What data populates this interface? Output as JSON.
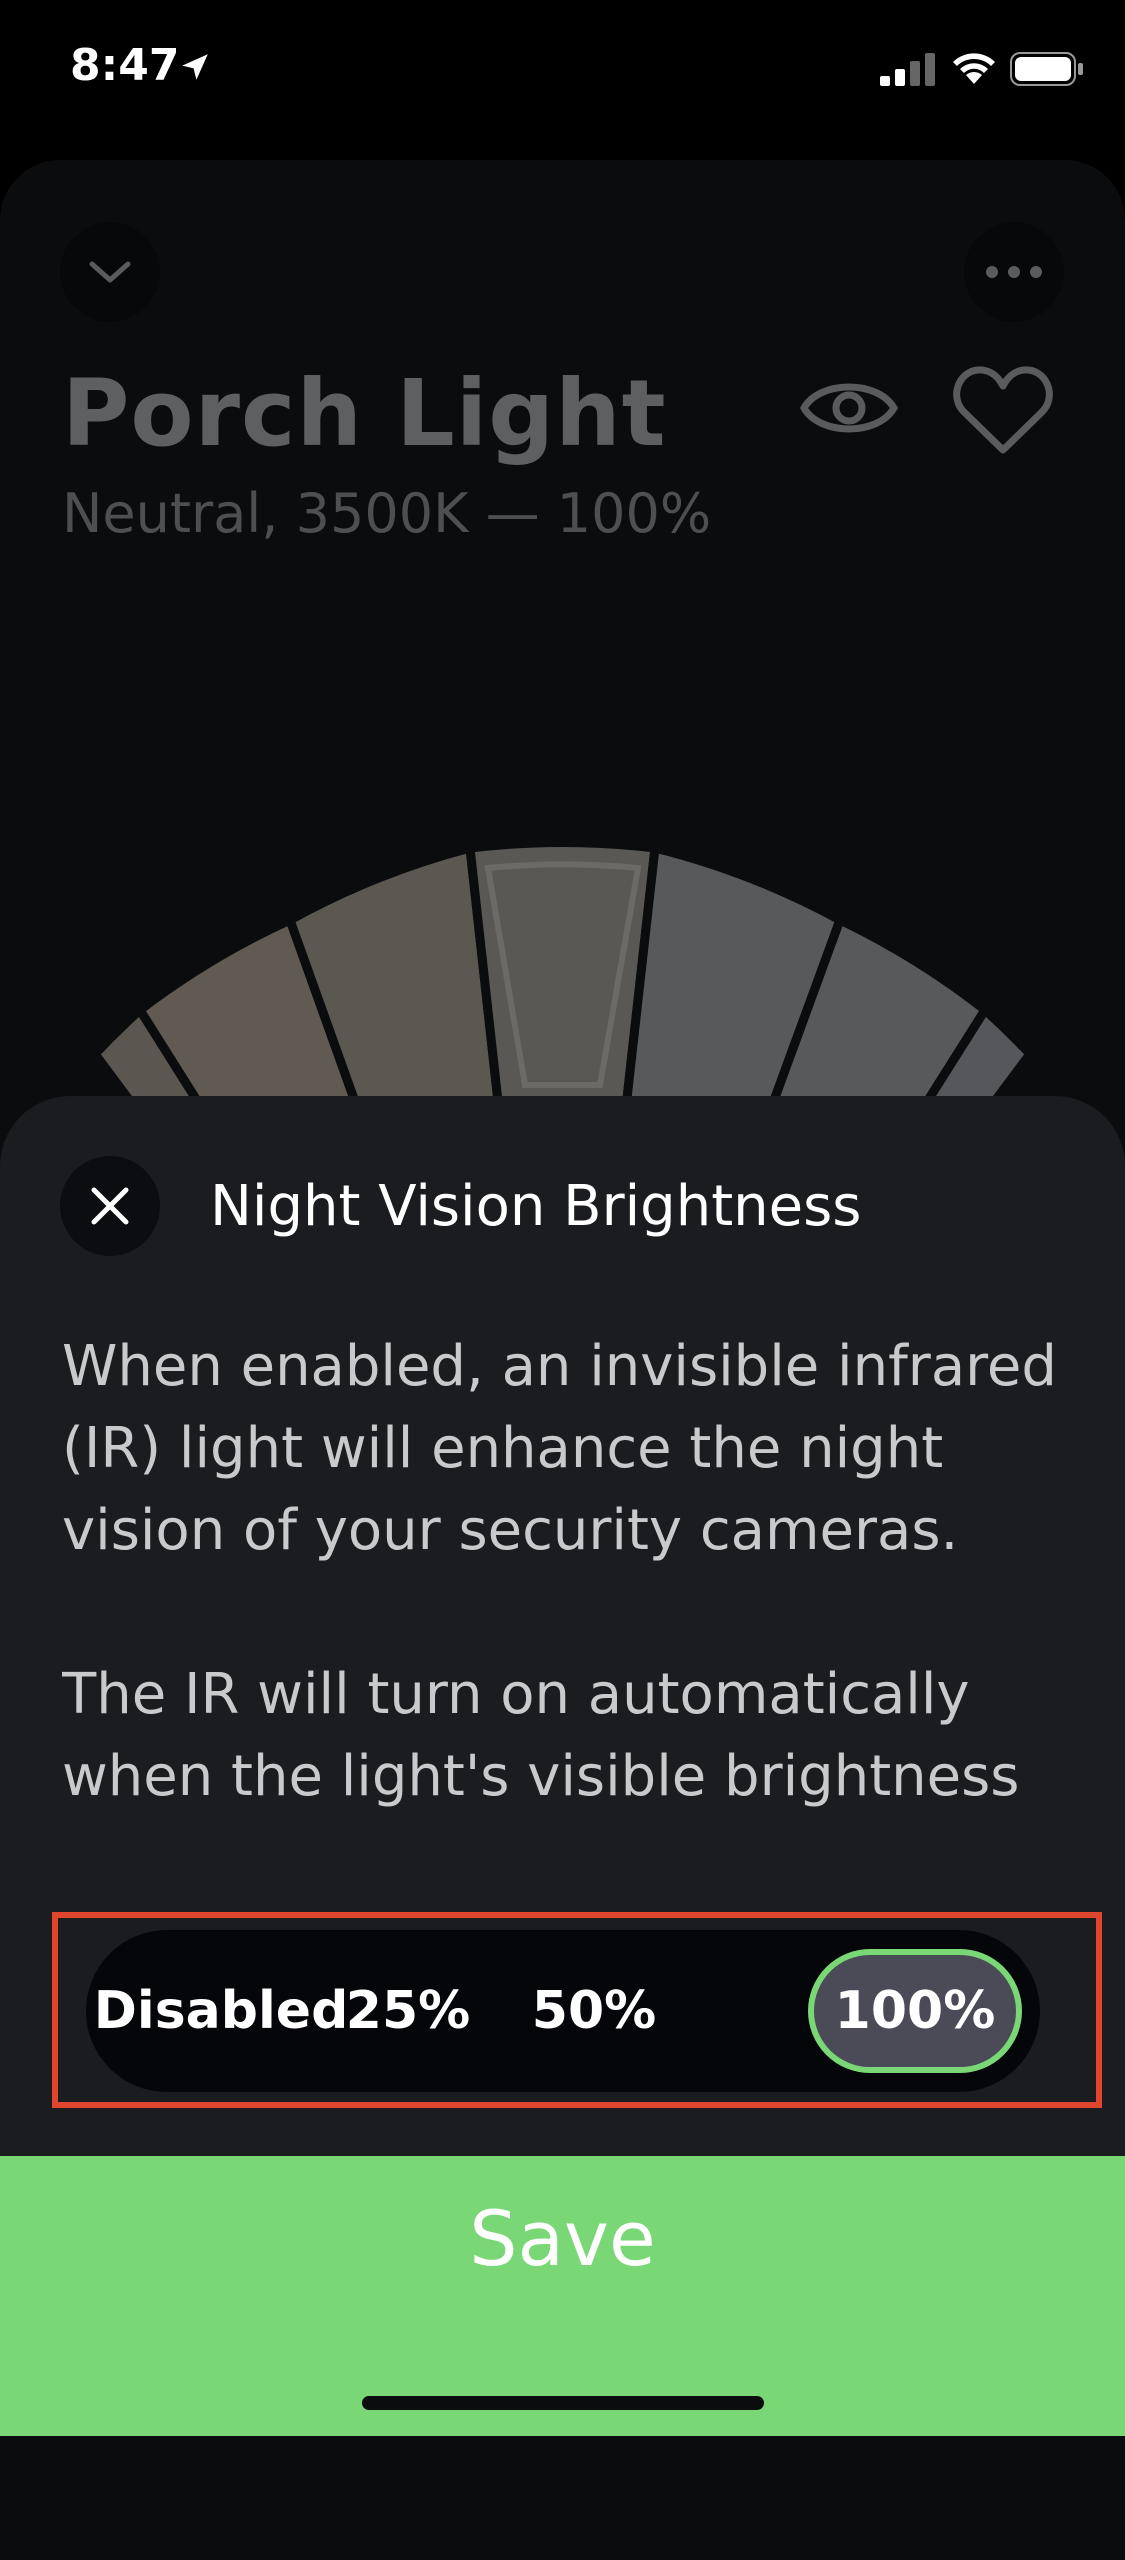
{
  "status_bar": {
    "time": "8:47",
    "icons": [
      "location-arrow-icon",
      "cellular-signal-icon",
      "wifi-icon",
      "battery-icon"
    ]
  },
  "header": {
    "title": "Porch Light",
    "subtitle": "Neutral, 3500K — 100%",
    "icons": [
      "chevron-down-icon",
      "more-icon",
      "eye-icon",
      "heart-icon"
    ]
  },
  "sheet": {
    "title": "Night Vision Brightness",
    "close_icon": "close-icon",
    "paragraph_1": "When enabled, an invisible infrared (IR) light will enhance the night vision of your security cameras.",
    "paragraph_2": "The IR will turn on automatically when the light's visible brightness"
  },
  "brightness_selector": {
    "options": [
      "Disabled",
      "25%",
      "50%",
      "100%"
    ],
    "selected": "100%"
  },
  "save_button": {
    "label": "Save"
  },
  "colors": {
    "accent": "#7ad776",
    "highlight": "#e0452d",
    "sheet_bg": "#1b1c1f",
    "selected_option_bg": "#4a4b56"
  }
}
